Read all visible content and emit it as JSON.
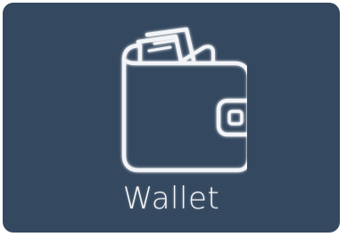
{
  "tile": {
    "label": "Wallet",
    "icon": "wallet-icon",
    "background_color": "#34485f",
    "foreground_color": "#f4f6f8"
  }
}
